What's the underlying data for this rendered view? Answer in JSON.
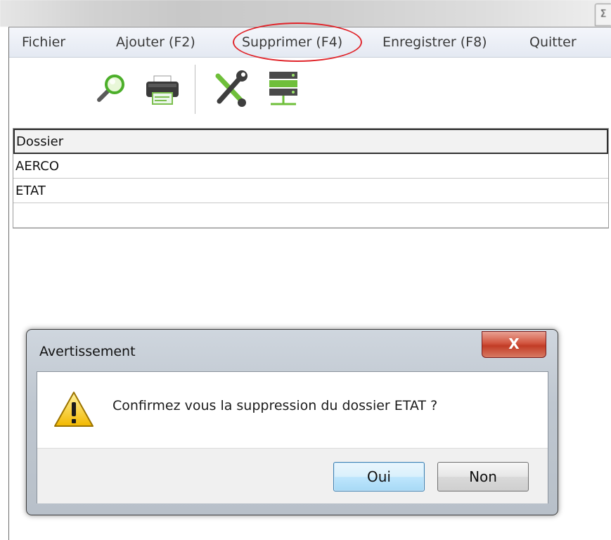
{
  "top_strip": {
    "cut_tab_glyph": "Σ"
  },
  "menu": {
    "items": [
      {
        "label": "Fichier"
      },
      {
        "label": "Ajouter (F2)"
      },
      {
        "label": "Supprimer (F4)"
      },
      {
        "label": "Enregistrer (F8)"
      },
      {
        "label": "Quitter"
      }
    ],
    "highlighted_item": "Supprimer (F4)",
    "highlight_color": "#e0242a"
  },
  "toolbar": {
    "icons": [
      "search-icon",
      "printer-icon",
      "tools-icon",
      "network-server-icon"
    ]
  },
  "grid": {
    "header": "Dossier",
    "rows": [
      "AERCO",
      "ETAT",
      ""
    ]
  },
  "dialog": {
    "title": "Avertissement",
    "close_glyph": "X",
    "message": "Confirmez vous la suppression du dossier ETAT ?",
    "icon": "warning-icon",
    "buttons": {
      "yes": "Oui",
      "no": "Non"
    }
  },
  "colors": {
    "close_button": "#c23c26",
    "default_button": "#bee6fd",
    "warning_yellow": "#f5c400"
  }
}
